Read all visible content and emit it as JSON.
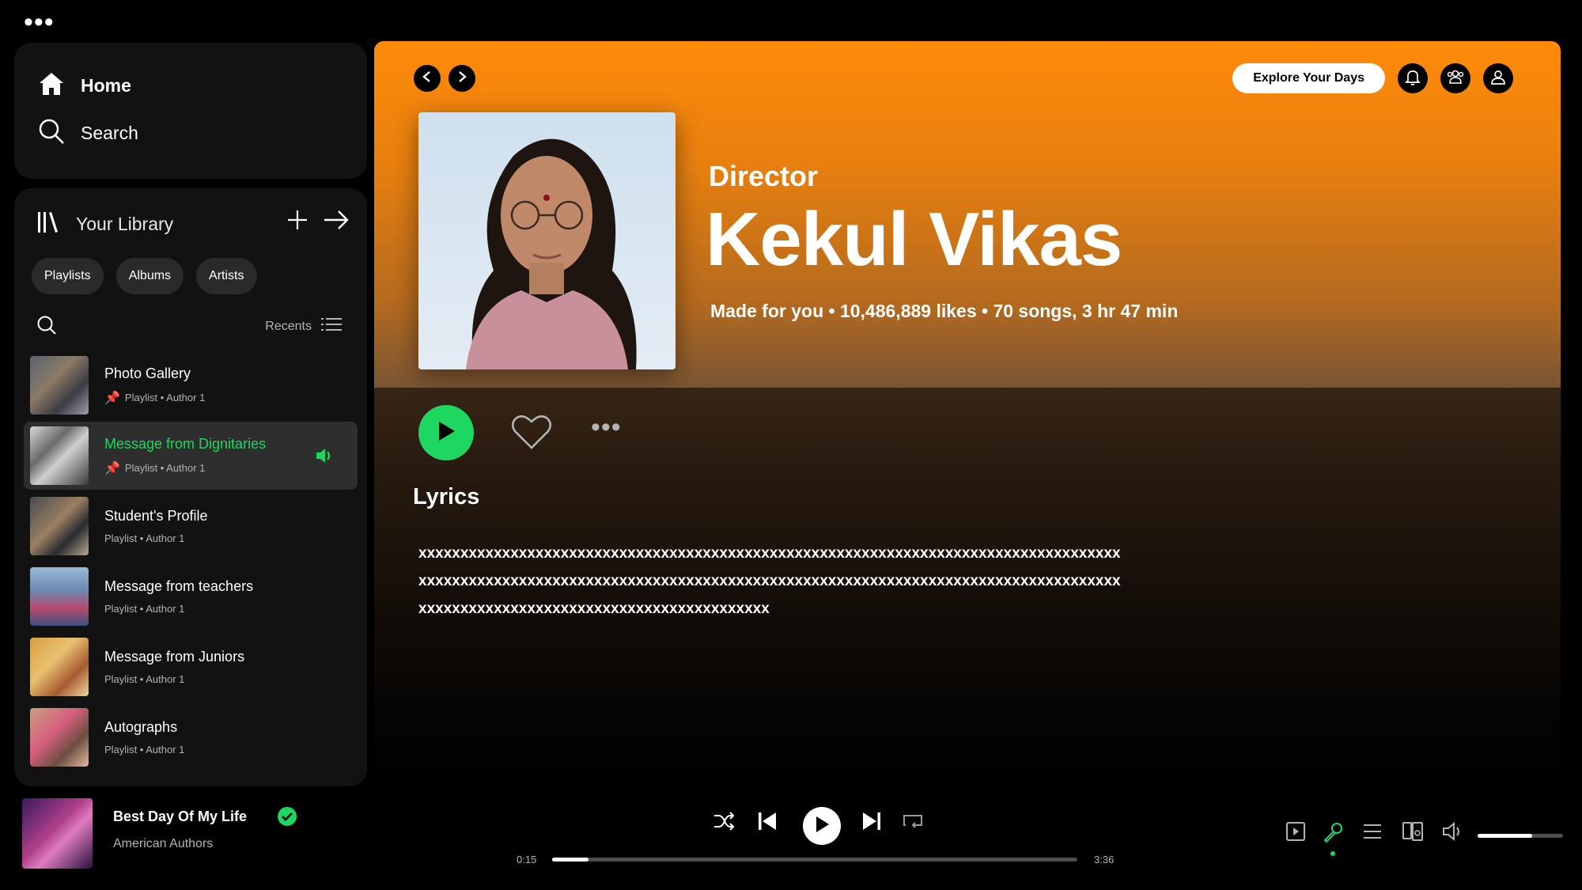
{
  "window": {
    "menu_dots": "•••"
  },
  "nav": {
    "home_label": "Home",
    "search_label": "Search"
  },
  "library": {
    "title": "Your Library",
    "chips": [
      "Playlists",
      "Albums",
      "Artists"
    ],
    "recents_label": "Recents",
    "items": [
      {
        "title": "Photo Gallery",
        "subtitle": "Playlist • Author 1",
        "pinned": true,
        "active": false
      },
      {
        "title": "Message from Dignitaries",
        "subtitle": "Playlist • Author 1",
        "pinned": true,
        "active": true
      },
      {
        "title": "Student's Profile",
        "subtitle": "Playlist • Author 1",
        "pinned": false,
        "active": false
      },
      {
        "title": "Message from teachers",
        "subtitle": "Playlist • Author 1",
        "pinned": false,
        "active": false
      },
      {
        "title": "Message from Juniors",
        "subtitle": "Playlist • Author 1",
        "pinned": false,
        "active": false
      },
      {
        "title": "Autographs",
        "subtitle": "Playlist • Author 1",
        "pinned": false,
        "active": false
      }
    ]
  },
  "topbar": {
    "explore_label": "Explore Your Days"
  },
  "hero": {
    "type_label": "Director",
    "title": "Kekul Vikas",
    "meta": "Made for you • 10,486,889 likes • 70 songs, 3 hr 47 min",
    "gradient_color": "#ff8a0a"
  },
  "actions": {
    "more_dots": "•••"
  },
  "lyrics": {
    "heading": "Lyrics",
    "lines": [
      "xxxxxxxxxxxxxxxxxxxxxxxxxxxxxxxxxxxxxxxxxxxxxxxxxxxxxxxxxxxxxxxxxxxxxxxxxxxxxxxxxxxx",
      "xxxxxxxxxxxxxxxxxxxxxxxxxxxxxxxxxxxxxxxxxxxxxxxxxxxxxxxxxxxxxxxxxxxxxxxxxxxxxxxxxxxx",
      "xxxxxxxxxxxxxxxxxxxxxxxxxxxxxxxxxxxxxxxxxx"
    ]
  },
  "now_playing": {
    "title": "Best Day Of My Life",
    "artist": "American Authors",
    "elapsed": "0:15",
    "duration": "3:36",
    "progress_fraction": 0.069,
    "volume_fraction": 0.64
  },
  "colors": {
    "accent": "#1ed760",
    "panel": "#121212"
  }
}
